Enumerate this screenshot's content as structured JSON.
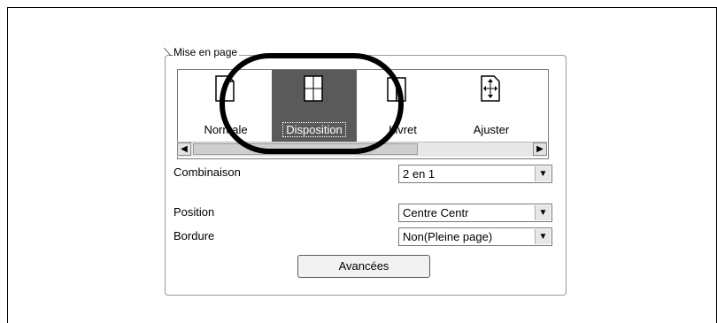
{
  "page_layout": {
    "group_label": "Mise en page",
    "layouts": [
      {
        "label": "Normale",
        "icon": "normal-page-icon",
        "selected": false
      },
      {
        "label": "Disposition",
        "icon": "layout-page-icon",
        "selected": true
      },
      {
        "label": "Livret",
        "icon": "booklet-page-icon",
        "selected": false
      },
      {
        "label": "Ajuster",
        "icon": "fit-page-icon",
        "selected": false
      }
    ]
  },
  "combinaison": {
    "label": "Combinaison",
    "value": "2 en 1"
  },
  "position": {
    "label": "Position",
    "value": "Centre Centr"
  },
  "bordure": {
    "label": "Bordure",
    "value": "Non(Pleine page)"
  },
  "advanced_button": {
    "label": "Avancées"
  },
  "colors": {
    "selected_bg": "#5a5a5a",
    "annotation": "#000000"
  }
}
